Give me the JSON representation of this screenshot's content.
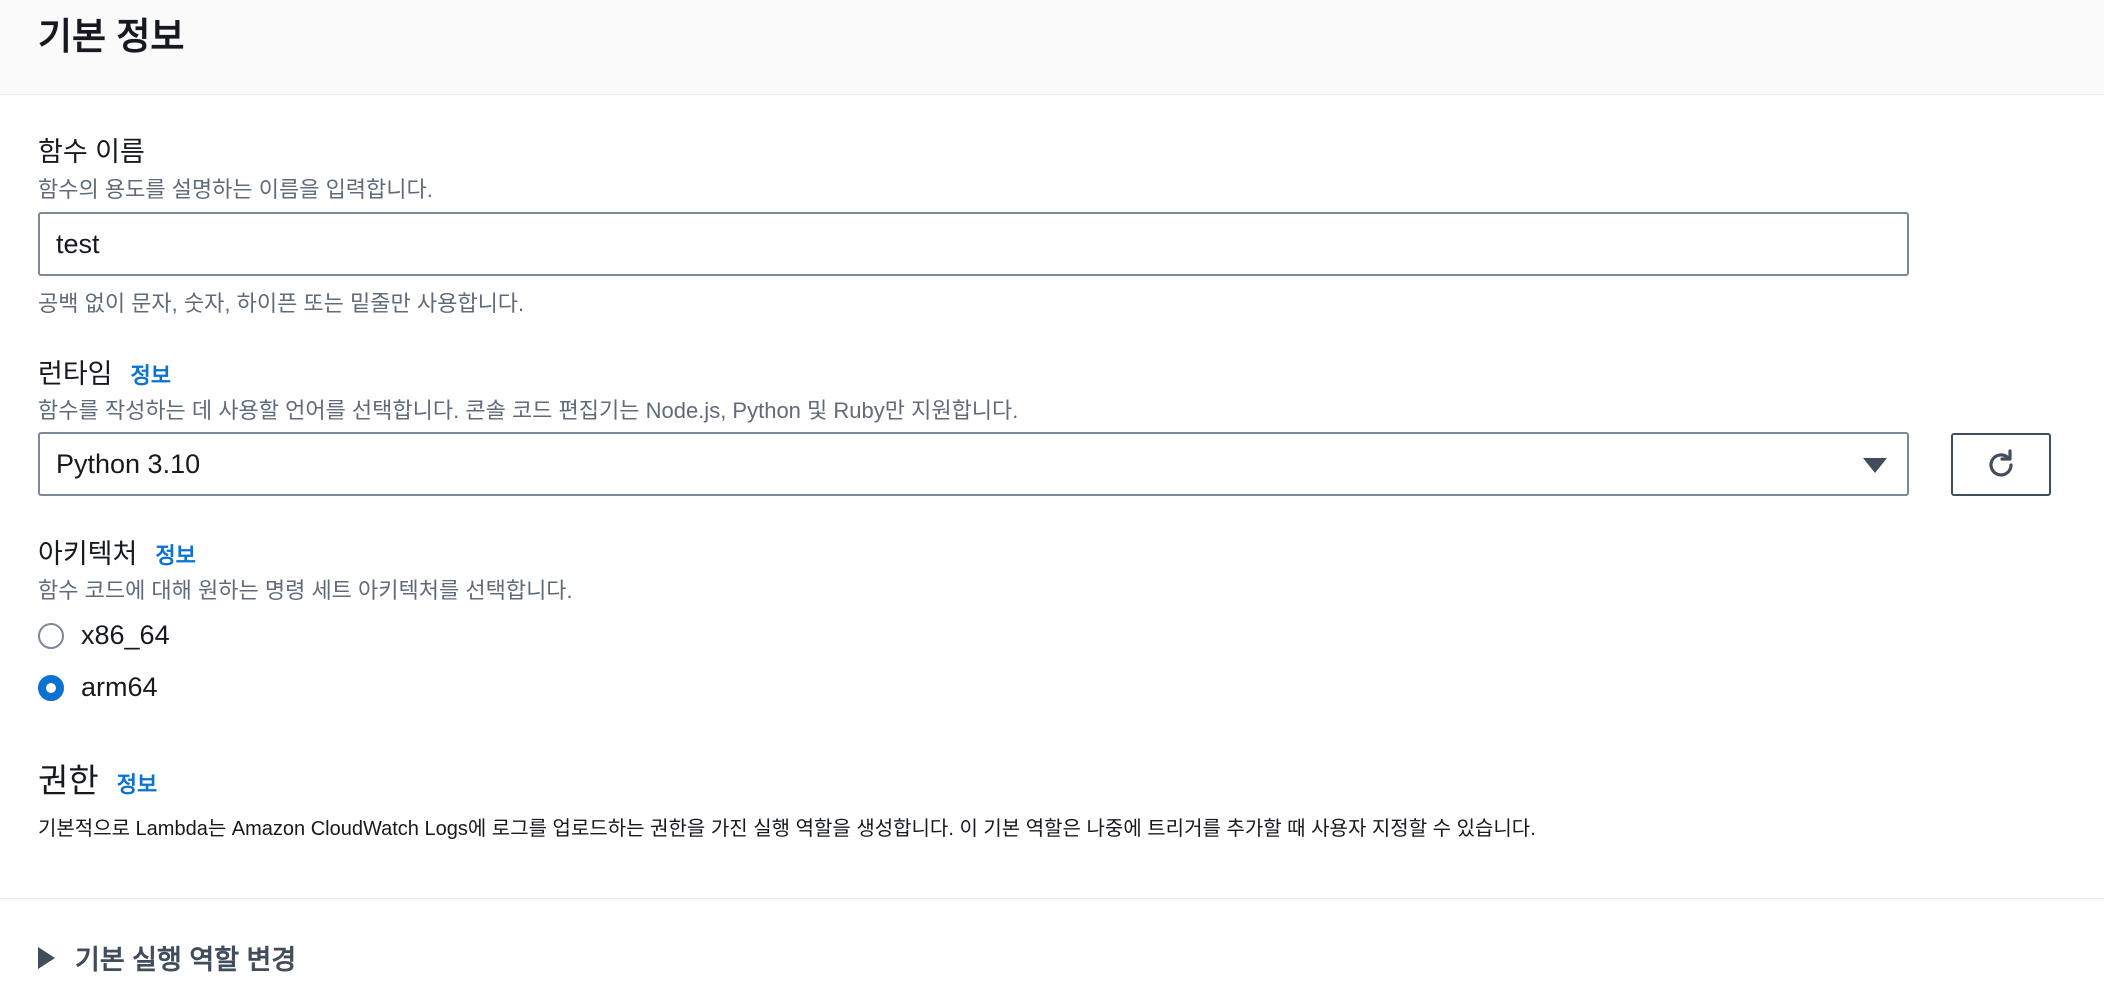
{
  "basic_info": {
    "title": "기본 정보"
  },
  "function_name": {
    "label": "함수 이름",
    "description": "함수의 용도를 설명하는 이름을 입력합니다.",
    "value": "test",
    "constraint": "공백 없이 문자, 숫자, 하이픈 또는 밑줄만 사용합니다."
  },
  "runtime": {
    "label": "런타임",
    "info": "정보",
    "description": "함수를 작성하는 데 사용할 언어를 선택합니다. 콘솔 코드 편집기는 Node.js, Python 및 Ruby만 지원합니다.",
    "selected": "Python 3.10",
    "refresh_icon": "refresh-icon"
  },
  "architecture": {
    "label": "아키텍처",
    "info": "정보",
    "description": "함수 코드에 대해 원하는 명령 세트 아키텍처를 선택합니다.",
    "options": [
      {
        "label": "x86_64",
        "checked": false
      },
      {
        "label": "arm64",
        "checked": true
      }
    ]
  },
  "permissions": {
    "title": "권한",
    "info": "정보",
    "description": "기본적으로 Lambda는 Amazon CloudWatch Logs에 로그를 업로드하는 권한을 가진 실행 역할을 생성합니다. 이 기본 역할은 나중에 트리거를 추가할 때 사용자 지정할 수 있습니다.",
    "expander_label": "기본 실행 역할 변경"
  },
  "colors": {
    "accent": "#0972d3",
    "text": "#16191f",
    "secondary_text": "#5f6b7a",
    "border": "#7d8998"
  }
}
